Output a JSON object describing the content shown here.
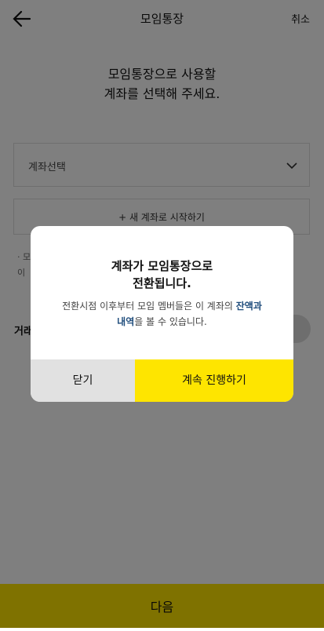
{
  "header": {
    "title": "모임통장",
    "cancel_label": "취소"
  },
  "main": {
    "headline_line1": "모임통장으로 사용할",
    "headline_line2": "계좌를 선택해 주세요.",
    "select_placeholder": "계좌선택",
    "new_account_label": "+ 새 계좌로 시작하기",
    "note_line1": "· 모",
    "note_line2": "이",
    "transaction_label": "거래"
  },
  "modal": {
    "title_line1": "계좌가 모임통장으로",
    "title_line2": "전환됩니다.",
    "desc_prefix": "전환시점 이후부터 모임 멤버들은 이 계좌의 ",
    "desc_bold1": "잔액과",
    "desc_bold2": "내역",
    "desc_suffix": "을 볼 수 있습니다.",
    "close_label": "닫기",
    "continue_label": "계속 진행하기"
  },
  "footer": {
    "next_label": "다음"
  },
  "colors": {
    "accent": "#fee500",
    "link": "#1e4c7c",
    "dim_overlay": "rgba(0,0,0,0.5)"
  }
}
